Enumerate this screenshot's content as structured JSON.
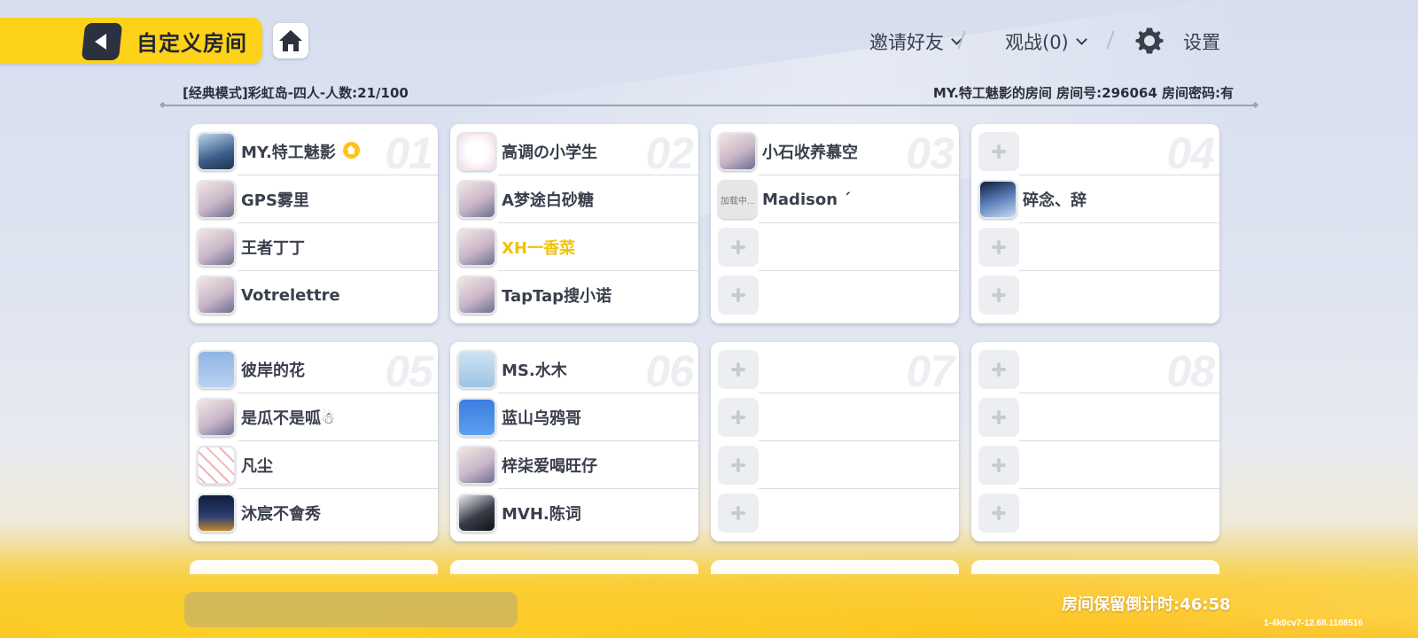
{
  "header": {
    "title": "自定义房间",
    "invite_label": "邀请好友",
    "spectate_label": "观战(0)",
    "settings_label": "设置"
  },
  "room": {
    "mode_info": "[经典模式]彩虹岛-四人-人数:21/100",
    "room_info": "MY.特工魅影的房间 房间号:296064 房间密码:有"
  },
  "teams": [
    {
      "number": "01",
      "players": [
        {
          "name": "MY.特工魅影",
          "avatar": "wizard-avatar",
          "owner": true
        },
        {
          "name": "GPS雾里",
          "avatar": "anime-avatar"
        },
        {
          "name": "王者丁丁",
          "avatar": "anime-avatar"
        },
        {
          "name": "Votrelettre",
          "avatar": "anime-avatar"
        }
      ]
    },
    {
      "number": "02",
      "players": [
        {
          "name": "高调の小学生",
          "avatar": "cloud-avatar"
        },
        {
          "name": "A梦途白砂糖",
          "avatar": "anime-avatar"
        },
        {
          "name": "XH一香菜",
          "avatar": "anime-avatar",
          "highlight": true
        },
        {
          "name": "TapTap搜小诺",
          "avatar": "anime-avatar"
        }
      ]
    },
    {
      "number": "03",
      "players": [
        {
          "name": "小石收养慕空",
          "avatar": "anime-avatar"
        },
        {
          "name": "Madison ´",
          "avatar": "loading-avatar",
          "loading_text": "加载中..."
        },
        null,
        null
      ]
    },
    {
      "number": "04",
      "players": [
        null,
        {
          "name": "碎念、辞",
          "avatar": "space-avatar"
        },
        null,
        null
      ]
    },
    {
      "number": "05",
      "players": [
        {
          "name": "彼岸的花",
          "avatar": "potato-avatar"
        },
        {
          "name": "是瓜不是呱☃",
          "avatar": "anime-avatar"
        },
        {
          "name": "凡尘",
          "avatar": "pattern-avatar"
        },
        {
          "name": "沐宸不會秀",
          "avatar": "night-avatar"
        }
      ]
    },
    {
      "number": "06",
      "players": [
        {
          "name": "MS.水木",
          "avatar": "robot-avatar"
        },
        {
          "name": "蓝山乌鸦哥",
          "avatar": "cartoon-avatar"
        },
        {
          "name": "梓柒爱喝旺仔",
          "avatar": "anime-avatar"
        },
        {
          "name": "MVH.陈词",
          "avatar": "dark-avatar"
        }
      ]
    },
    {
      "number": "07",
      "players": [
        null,
        null,
        null,
        null
      ]
    },
    {
      "number": "08",
      "players": [
        null,
        null,
        null,
        null
      ]
    }
  ],
  "footer": {
    "countdown": "房间保留倒计时:46:58",
    "version": "1-4k0cv7-12.68.1188516"
  },
  "colors": {
    "accent": "#ffd21a",
    "highlight_name": "#f2c200",
    "dark_button": "#2c3140"
  }
}
